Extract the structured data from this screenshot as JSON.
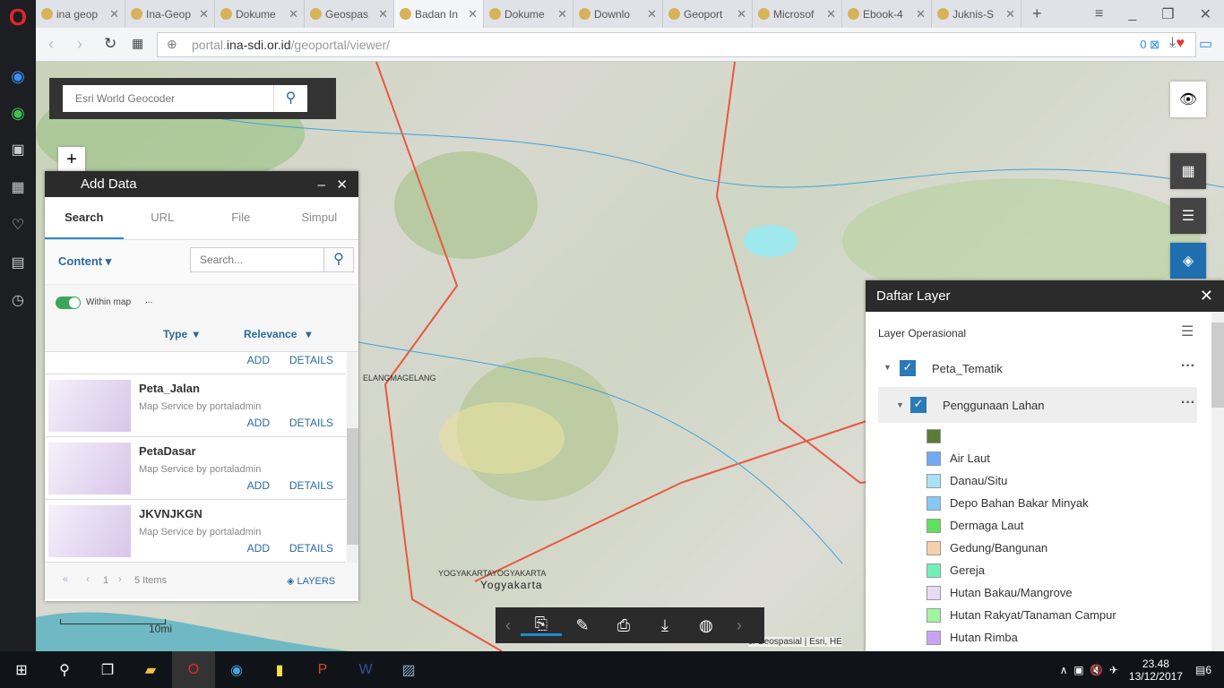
{
  "browser": {
    "tabs": [
      "ina geop",
      "Ina-Geop",
      "Dokume",
      "Geospas",
      "Badan In",
      "Dokume",
      "Downlo",
      "Geoport",
      "Microsof",
      "Ebook-4",
      "Juknis-S"
    ],
    "active_tab": 4,
    "url_prefix": "portal.",
    "url_host": "ina-sdi.or.id",
    "url_path": "/geoportal/viewer/",
    "blocked_count": "0"
  },
  "search": {
    "placeholder": "Esri World Geocoder"
  },
  "zoom": {
    "in": "+",
    "out": "−"
  },
  "add_data": {
    "title": "Add Data",
    "tabs": [
      "Search",
      "URL",
      "File",
      "Simpul"
    ],
    "content_label": "Content",
    "search_placeholder": "Search...",
    "within_map": "Within map",
    "ellipsis": "...",
    "type_label": "Type",
    "relevance_label": "Relevance",
    "add": "ADD",
    "details": "DETAILS",
    "results": [
      {
        "name": "Peta_Jalan",
        "sub": "Map Service by portaladmin"
      },
      {
        "name": "PetaDasar",
        "sub": "Map Service by portaladmin"
      },
      {
        "name": "JKVNJKGN",
        "sub": "Map Service by portaladmin"
      }
    ],
    "page": "1",
    "items": "5 Items",
    "layers": "LAYERS"
  },
  "map_labels": {
    "magelang": "ELANGMAGELANG",
    "yogya1": "YOGYAKARTAYOGYAKARTA",
    "yogya2": "Yogyakarta",
    "scale": "10mi",
    "attribution": "si Geospasial | Esri, HE"
  },
  "layer_list": {
    "title": "Daftar Layer",
    "section": "Layer Operasional",
    "group": "Peta_Tematik",
    "layer": "Penggunaan Lahan",
    "legend": [
      {
        "label": "",
        "color": "#5b7a35"
      },
      {
        "label": "Air Laut",
        "color": "#70aaf5"
      },
      {
        "label": "Danau/Situ",
        "color": "#a8e2f3"
      },
      {
        "label": "Depo Bahan Bakar Minyak",
        "color": "#86c8f5"
      },
      {
        "label": "Dermaga Laut",
        "color": "#5fe05f"
      },
      {
        "label": "Gedung/Bangunan",
        "color": "#f6d0aa"
      },
      {
        "label": "Gereja",
        "color": "#70f0b9"
      },
      {
        "label": "Hutan Bakau/Mangrove",
        "color": "#e7dbf6"
      },
      {
        "label": "Hutan Rakyat/Tanaman Campur",
        "color": "#a0f5a0"
      },
      {
        "label": "Hutan Rimba",
        "color": "#c7a4f2"
      }
    ]
  },
  "taskbar": {
    "time": "23.48",
    "date": "13/12/2017",
    "notifications": "6"
  }
}
